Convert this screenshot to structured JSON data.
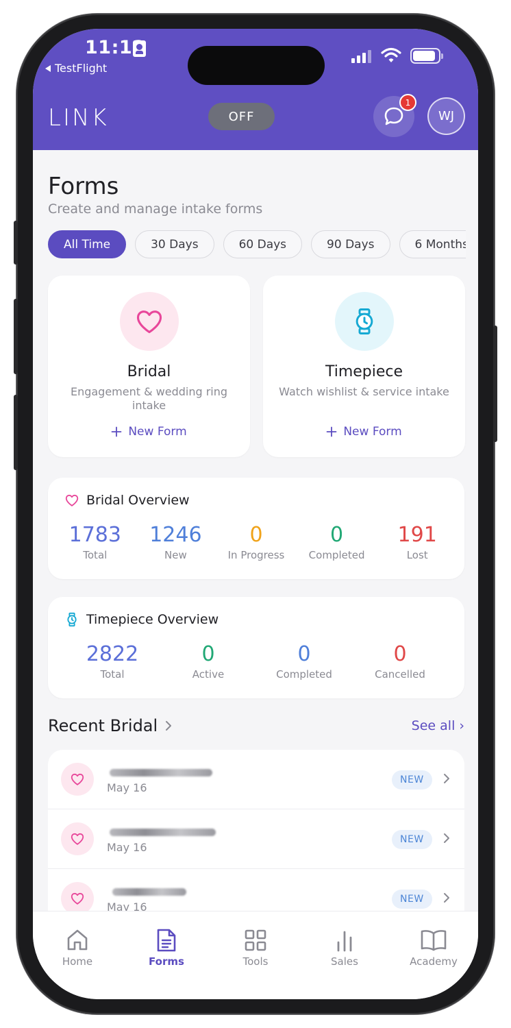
{
  "status": {
    "time": "11:12",
    "back_app": "TestFlight"
  },
  "header": {
    "logo": "LINK",
    "toggle_label": "OFF",
    "chat_badge_count": "1",
    "avatar_initials": "WJ",
    "color": "#5f4fc2"
  },
  "page": {
    "title": "Forms",
    "subtitle": "Create and manage intake forms"
  },
  "filters": [
    "All Time",
    "30 Days",
    "60 Days",
    "90 Days",
    "6 Months"
  ],
  "form_cards": [
    {
      "title": "Bridal",
      "description": "Engagement & wedding ring intake",
      "action": "New Form",
      "icon": "heart-icon",
      "icon_color": "#e8479a"
    },
    {
      "title": "Timepiece",
      "description": "Watch wishlist & service intake",
      "action": "New Form",
      "icon": "watch-icon",
      "icon_color": "#16a9d3"
    }
  ],
  "bridal_overview": {
    "title": "Bridal Overview",
    "stats": [
      {
        "value": "1783",
        "label": "Total",
        "color": "#5b6fd8"
      },
      {
        "value": "1246",
        "label": "New",
        "color": "#4f7fd9"
      },
      {
        "value": "0",
        "label": "In Progress",
        "color": "#f0a31a"
      },
      {
        "value": "0",
        "label": "Completed",
        "color": "#21a875"
      },
      {
        "value": "191",
        "label": "Lost",
        "color": "#e04848"
      }
    ]
  },
  "timepiece_overview": {
    "title": "Timepiece Overview",
    "stats": [
      {
        "value": "2822",
        "label": "Total",
        "color": "#5b6fd8"
      },
      {
        "value": "0",
        "label": "Active",
        "color": "#21a875"
      },
      {
        "value": "0",
        "label": "Completed",
        "color": "#4f7fd9"
      },
      {
        "value": "0",
        "label": "Cancelled",
        "color": "#e04848"
      }
    ]
  },
  "recent_bridal": {
    "title": "Recent Bridal",
    "see_all": "See all ›",
    "items": [
      {
        "date": "May 16",
        "status": "NEW"
      },
      {
        "date": "May 16",
        "status": "NEW"
      },
      {
        "date": "May 16",
        "status": "NEW"
      }
    ]
  },
  "tabs": [
    {
      "label": "Home",
      "icon": "home-icon"
    },
    {
      "label": "Forms",
      "icon": "document-icon",
      "active": true
    },
    {
      "label": "Tools",
      "icon": "grid-icon"
    },
    {
      "label": "Sales",
      "icon": "bar-chart-icon"
    },
    {
      "label": "Academy",
      "icon": "book-icon"
    }
  ]
}
